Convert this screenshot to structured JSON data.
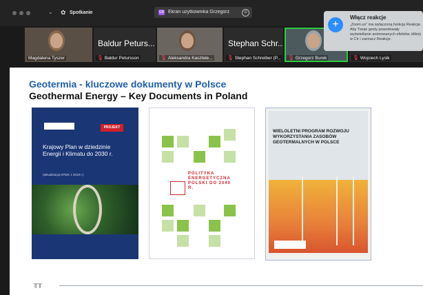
{
  "window": {
    "app_title": "Spotkanie",
    "share_badge": "GB",
    "share_label": "Ekran użytkownika Grzegorz",
    "more_glyph": "⊖"
  },
  "participants": [
    {
      "name": "Magdalena Tyszer",
      "big": "",
      "video": true,
      "muted": false,
      "active": false
    },
    {
      "name": "Baldur Petursson",
      "big": "Baldur Peturs...",
      "video": false,
      "muted": true,
      "active": false
    },
    {
      "name": "Aleksandra Kasztele...",
      "big": "",
      "video": true,
      "muted": true,
      "active": false
    },
    {
      "name": "Stephan Schreiber (P...",
      "big": "Stephan Schr...",
      "video": false,
      "muted": true,
      "active": false
    },
    {
      "name": "Grzegorz Burek",
      "big": "",
      "video": true,
      "muted": true,
      "active": true
    },
    {
      "name": "Wojciech Lysik",
      "big": "",
      "video": false,
      "muted": true,
      "active": false
    }
  ],
  "notification": {
    "title": "Włącz reakcje",
    "body": "„Zoom.us” ma wyłączoną funkcję Reakcje. Aby Twoje gesty powodowały wyświetlanie animowanych efektów, kliknij w CIr i zaznacz Reakcje."
  },
  "slide": {
    "title_pl": "Geotermia - kluczowe dokumenty w Polsce",
    "title_en": "Geothermal Energy – Key Documents in Poland",
    "doc1": {
      "badge": "PROJEKT",
      "title": "Krajowy Plan w dziedzinie Energii i Klimatu do 2030 r.",
      "subtitle": "(aktualizacja KPEiK z 2019 r.)"
    },
    "doc2": {
      "title": "POLITYKA ENERGETYCZNA POLSKI DO 2040 R."
    },
    "doc3": {
      "title": "WIELOLETNI PROGRAM ROZWOJU WYKORZYSTANIA ZASOBÓW GEOTERMALNYCH W POLSCE"
    },
    "footer_logo": "𝍯𝍯"
  },
  "icons": {
    "chevron": "⌄",
    "app": "✿",
    "mic_muted": "🎙",
    "reaction_add": "+"
  },
  "colors": {
    "accent_blue": "#2d8cff",
    "active_green": "#2ecc40",
    "muted_red": "#ff4b4b",
    "title_blue": "#1f5fa8"
  }
}
